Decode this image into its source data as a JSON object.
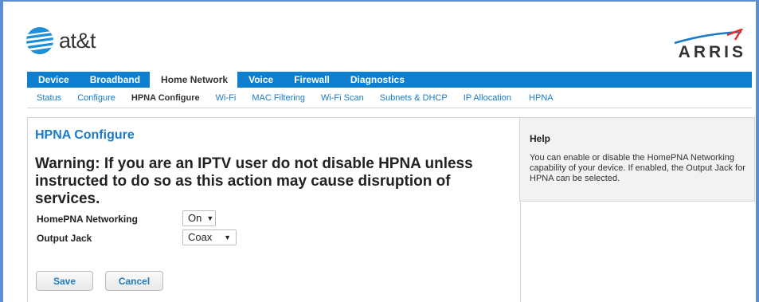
{
  "brand": {
    "att_label": "at&t",
    "arris_label": "ARRIS"
  },
  "nav": {
    "tabs": [
      {
        "label": "Device"
      },
      {
        "label": "Broadband"
      },
      {
        "label": "Home Network",
        "active": true
      },
      {
        "label": "Voice"
      },
      {
        "label": "Firewall"
      },
      {
        "label": "Diagnostics"
      }
    ]
  },
  "subnav": {
    "items": [
      {
        "label": "Status"
      },
      {
        "label": "Configure"
      },
      {
        "label": "HPNA Configure",
        "active": true
      },
      {
        "label": "Wi-Fi"
      },
      {
        "label": "MAC Filtering"
      },
      {
        "label": "Wi-Fi Scan"
      },
      {
        "label": "Subnets & DHCP"
      },
      {
        "label": "IP Allocation"
      },
      {
        "label": "HPNA"
      }
    ]
  },
  "main": {
    "title": "HPNA Configure",
    "warning": "Warning: If you are an IPTV user do not disable HPNA unless instructed to do so as this action may cause disruption of services.",
    "fields": {
      "homepna_label": "HomePNA Networking",
      "homepna_value": "On",
      "output_jack_label": "Output Jack",
      "output_jack_value": "Coax"
    },
    "buttons": {
      "save": "Save",
      "cancel": "Cancel"
    }
  },
  "help": {
    "title": "Help",
    "text": "You can enable or disable the HomePNA Networking capability of your device. If enabled, the Output Jack for HPNA can be selected."
  },
  "colors": {
    "nav_blue": "#0e7fcf",
    "link_blue": "#1a7ac6",
    "frame_blue": "#5b8fd0"
  }
}
